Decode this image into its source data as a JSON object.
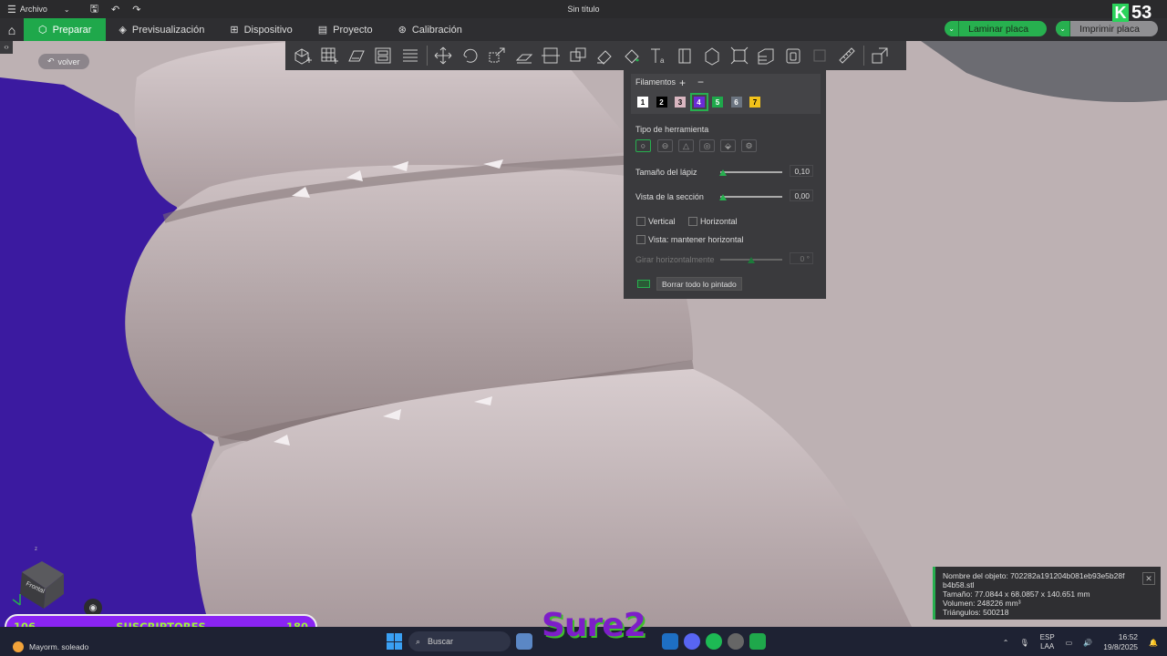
{
  "titlebar": {
    "menu_label": "Archivo",
    "window_title": "Sin título"
  },
  "nav": {
    "tabs": [
      {
        "label": "Preparar",
        "icon": "cube-icon",
        "active": true
      },
      {
        "label": "Previsualización",
        "icon": "layers-icon"
      },
      {
        "label": "Dispositivo",
        "icon": "device-icon"
      },
      {
        "label": "Proyecto",
        "icon": "project-icon"
      },
      {
        "label": "Calibración",
        "icon": "calibration-icon"
      }
    ],
    "slice_button": "Laminar placa",
    "print_button": "Imprimir placa"
  },
  "viewport": {
    "back_label": "volver",
    "cube_face": "Frontal",
    "mesh_color": "#bfb3b5",
    "background_color": "#3b1aa0"
  },
  "paint_panel": {
    "filaments_title": "Filamentos",
    "add_symbol": "+",
    "remove_symbol": "−",
    "filaments": [
      {
        "num": "1",
        "color": "#ffffff",
        "text": "#000000"
      },
      {
        "num": "2",
        "color": "#000000",
        "text": "#ffffff"
      },
      {
        "num": "3",
        "color": "#d9b6c0",
        "text": "#000000"
      },
      {
        "num": "4",
        "color": "#6a2bd6",
        "text": "#ffffff",
        "selected": true
      },
      {
        "num": "5",
        "color": "#1fa84b",
        "text": "#ffffff"
      },
      {
        "num": "6",
        "color": "#6b7480",
        "text": "#ffffff"
      },
      {
        "num": "7",
        "color": "#f2c21a",
        "text": "#000000"
      }
    ],
    "tool_type_label": "Tipo de herramienta",
    "pencil_size_label": "Tamaño del lápiz",
    "pencil_size_value": "0,10",
    "pencil_size_level": 0.0,
    "section_view_label": "Vista de la sección",
    "section_view_value": "0,00",
    "section_view_level": 0.0,
    "vertical_label": "Vertical",
    "horizontal_label": "Horizontal",
    "keep_horizontal_label": "Vista: mantener horizontal",
    "rotate_label": "Girar horizontalmente",
    "rotate_value": "0 °",
    "rotate_level": 0.5,
    "clear_button": "Borrar todo lo pintado"
  },
  "info": {
    "name_line": "Nombre del objeto: 702282a191204b081eb93e5b28f",
    "name_line2": "b4b58.stl",
    "size_line": "Tamaño: 77.0844 x 68.0857 x 140.651 mm",
    "volume_line": "Volumen: 248226 mm³",
    "triangles_line": "Triángulos: 500218"
  },
  "overlays": {
    "subs_left": "106",
    "subs_label": "SUSCRIPTORES",
    "subs_right": "180",
    "logo_text": "Sure2",
    "badge_letter": "K",
    "badge_number": "53"
  },
  "taskbar": {
    "weather": "Mayorm. soleado",
    "search_placeholder": "Buscar",
    "lang_top": "ESP",
    "lang_bottom": "LAA",
    "time": "16:52",
    "date": "19/8/2025"
  }
}
